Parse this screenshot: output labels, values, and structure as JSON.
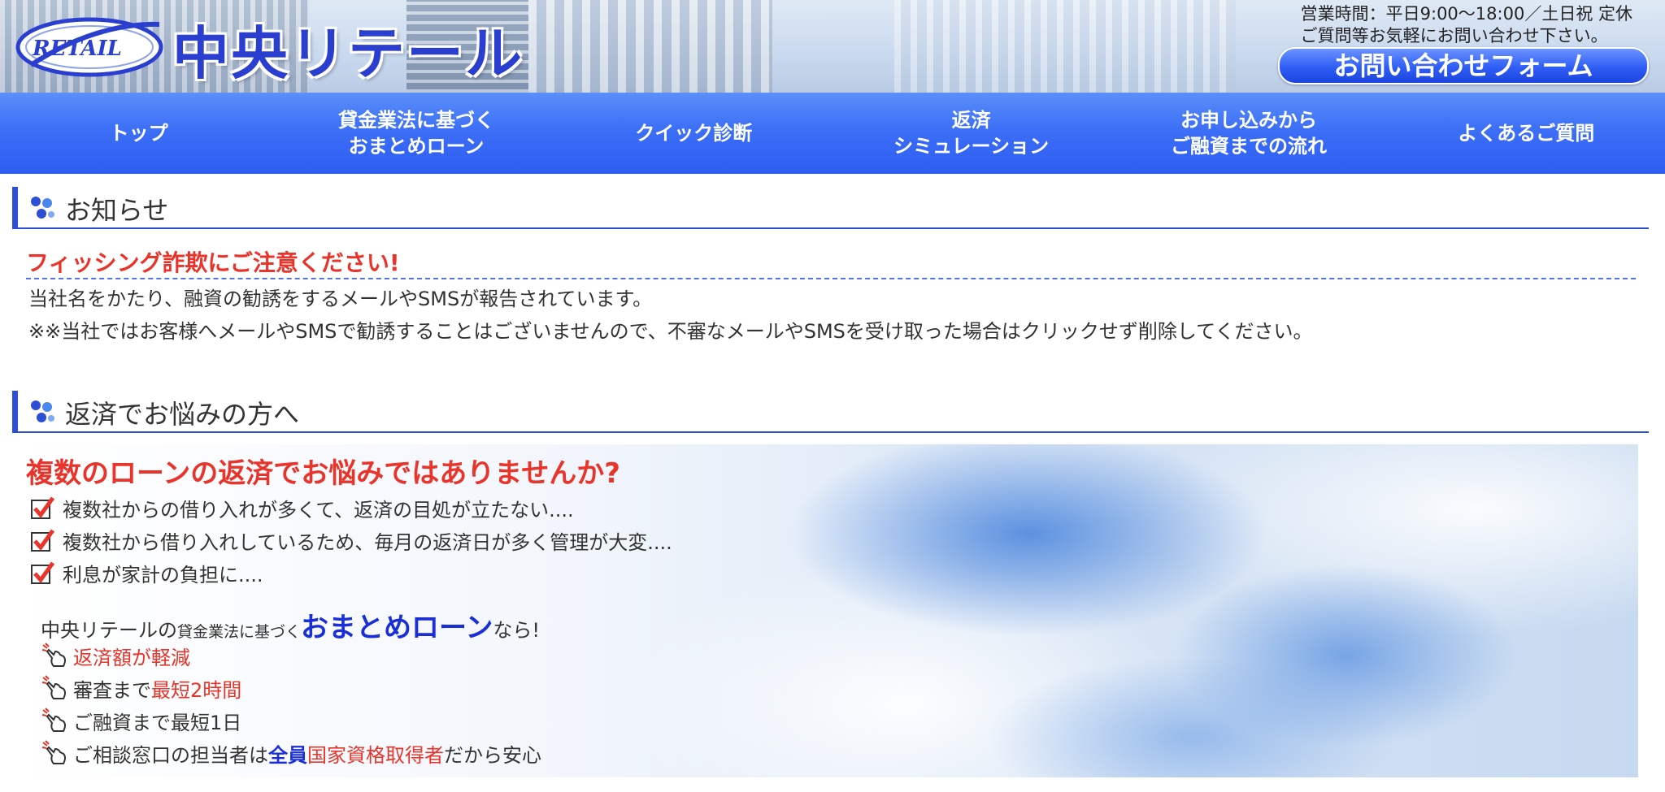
{
  "header": {
    "logo_emblem_text": "RETAIL",
    "logo_text": "中央リテール",
    "hours_line1": "営業時間：平日9:00～18:00／土日祝 定休",
    "hours_line2": "ご質問等お気軽にお問い合わせ下さい。",
    "contact_button": "お問い合わせフォーム"
  },
  "nav": {
    "items": [
      {
        "label": "トップ"
      },
      {
        "label": "貸金業法に基づく\nおまとめローン"
      },
      {
        "label": "クイック診断"
      },
      {
        "label": "返済\nシミュレーション"
      },
      {
        "label": "お申し込みから\nご融資までの流れ"
      },
      {
        "label": "よくあるご質問"
      }
    ]
  },
  "news": {
    "title": "お知らせ",
    "headline": "フィッシング詐欺にご注意ください!",
    "line1": "当社名をかたり、融資の勧誘をするメールやSMSが報告されています。",
    "line2": "※※当社ではお客様へメールやSMSで勧誘することはございませんので、不審なメールやSMSを受け取った場合はクリックせず削除してください。"
  },
  "trouble": {
    "title": "返済でお悩みの方へ",
    "headline": "複数のローンの返済でお悩みではありませんか?",
    "checks": [
      "複数社からの借り入れが多くて、返済の目処が立たない....",
      "複数社から借り入れしているため、毎月の返済日が多く管理が大変....",
      "利息が家計の負担に...."
    ],
    "lead": {
      "part1": "中央リテールの",
      "part2": "貸金業法に基づく",
      "part3": "おまとめローン",
      "part4": "なら!"
    },
    "merits": [
      {
        "a": "",
        "a_red": "返済額が軽減",
        "b": "",
        "b_blue": "",
        "c": ""
      },
      {
        "a": "審査まで",
        "a_red": "最短2時間",
        "b": "",
        "b_blue": "",
        "c": ""
      },
      {
        "a": "ご融資まで最短1日",
        "a_red": "",
        "b": "",
        "b_blue": "",
        "c": ""
      },
      {
        "a": "ご相談窓口の担当者は",
        "a_red": "",
        "b_blue": "全員",
        "b": "国家資格取得者",
        "c": "だから安心"
      }
    ]
  },
  "colors": {
    "nav_blue": "#3d6ff7",
    "accent_red": "#e8342a",
    "heading_blue": "#2d4fd6",
    "emphasis_blue": "#1a2fd6"
  }
}
